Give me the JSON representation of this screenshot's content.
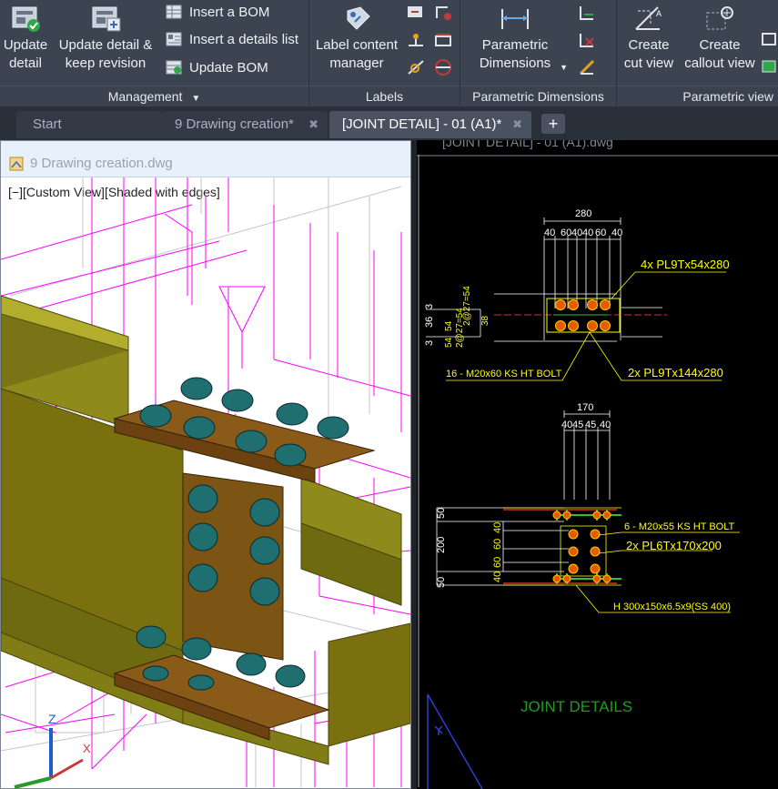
{
  "ribbon": {
    "management": {
      "update_detail": "Update\ndetail",
      "update_detail_keep": "Update detail &\nkeep revision",
      "insert_bom": "Insert a BOM",
      "insert_details_list": "Insert a details list",
      "update_bom": "Update BOM",
      "title": "Management"
    },
    "labels": {
      "label_content_manager": "Label content\nmanager",
      "title": "Labels"
    },
    "parametric_dimensions": {
      "button": "Parametric\nDimensions",
      "title": "Parametric Dimensions"
    },
    "parametric_view": {
      "create_cut_view": "Create\ncut view",
      "create_callout_view": "Create\ncallout view",
      "title": "Parametric view"
    }
  },
  "tabs": [
    {
      "label": "Start"
    },
    {
      "label": "9 Drawing creation*"
    },
    {
      "label": "[JOINT DETAIL] - 01 (A1)*"
    }
  ],
  "left_viewport": {
    "title": "9 Drawing creation.dwg",
    "view_label": "[−][Custom View][Shaded with edges]"
  },
  "right_viewport": {
    "title": "[JOINT DETAIL] - 01 (A1).dwg",
    "top_detail": {
      "overall_dim": "280",
      "segment_dims": [
        "40",
        "60",
        "40",
        "40",
        "60",
        "40"
      ],
      "left_dims": [
        "3",
        "36",
        "3"
      ],
      "left_small": [
        "2@27=54",
        "2@27=54",
        "54",
        "54",
        "38"
      ],
      "labels": [
        "4x  PL9Tx54x280",
        "16 - M20x60 KS HT BOLT",
        "2x  PL9Tx144x280"
      ]
    },
    "bottom_detail": {
      "overall_dim": "170",
      "segment_dims": [
        "40",
        "45",
        "45",
        "40"
      ],
      "left_dims": [
        "50",
        "200",
        "50"
      ],
      "left_small": [
        "40",
        "60",
        "60",
        "40"
      ],
      "labels": [
        "6 - M20x55 KS HT BOLT",
        "2x  PL6Tx170x200",
        "H  300x150x6.5x9(SS 400)"
      ]
    },
    "footer_title": "JOINT DETAILS"
  },
  "colors": {
    "ribbon_bg": "#3c4452",
    "accent_magenta": "#ff00ff",
    "steel_olive": "#7a7010",
    "bolt_teal": "#1e6b6b",
    "cad_yellow": "#ffff00",
    "cad_green": "#1f9c1f"
  }
}
